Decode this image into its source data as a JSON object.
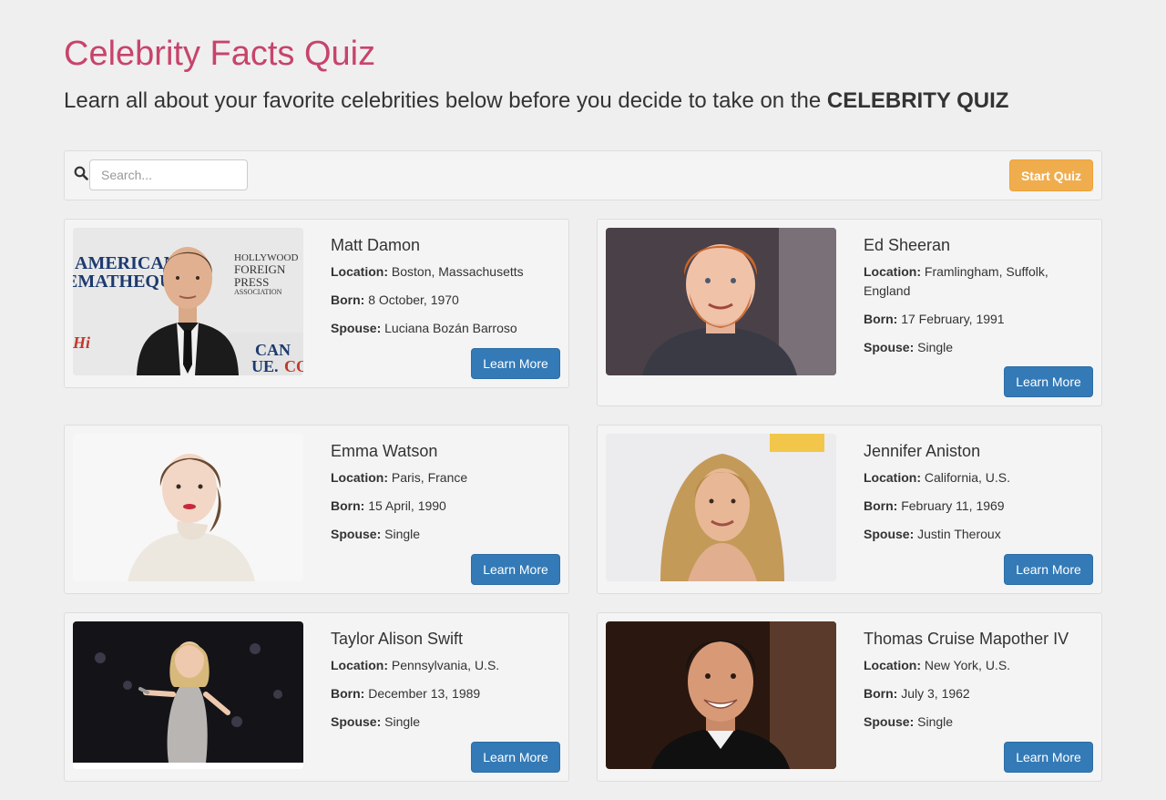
{
  "header": {
    "title": "Celebrity Facts Quiz",
    "subtitle_text": "Learn all about your favorite celebrities below before you decide to take on the ",
    "subtitle_strong": "CELEBRITY QUIZ"
  },
  "toolbar": {
    "search_placeholder": "Search...",
    "start_label": "Start Quiz"
  },
  "labels": {
    "location": "Location:",
    "born": "Born:",
    "spouse": "Spouse:",
    "learn_more": "Learn More"
  },
  "celebrities": [
    {
      "name": "Matt Damon",
      "location": "Boston, Massachusetts",
      "born": "8 October, 1970",
      "spouse": "Luciana Bozán Barroso",
      "photo_text_1": "AMERICAN",
      "photo_text_2": "EMATHEQUE.C",
      "photo_text_3": "HOLLYWOOD",
      "photo_text_4": "FOREIGN",
      "photo_text_5": "PRESS",
      "photo_text_6": "ASSOCIATION"
    },
    {
      "name": "Ed Sheeran",
      "location": "Framlingham, Suffolk, England",
      "born": "17 February, 1991",
      "spouse": "Single"
    },
    {
      "name": "Emma Watson",
      "location": "Paris, France",
      "born": "15 April, 1990",
      "spouse": "Single"
    },
    {
      "name": "Jennifer Aniston",
      "location": "California, U.S.",
      "born": "February 11, 1969",
      "spouse": "Justin Theroux"
    },
    {
      "name": "Taylor Alison Swift",
      "location": "Pennsylvania, U.S.",
      "born": "December 13, 1989",
      "spouse": "Single"
    },
    {
      "name": "Thomas Cruise Mapother IV",
      "location": "New York, U.S.",
      "born": "July 3, 1962",
      "spouse": "Single"
    }
  ]
}
